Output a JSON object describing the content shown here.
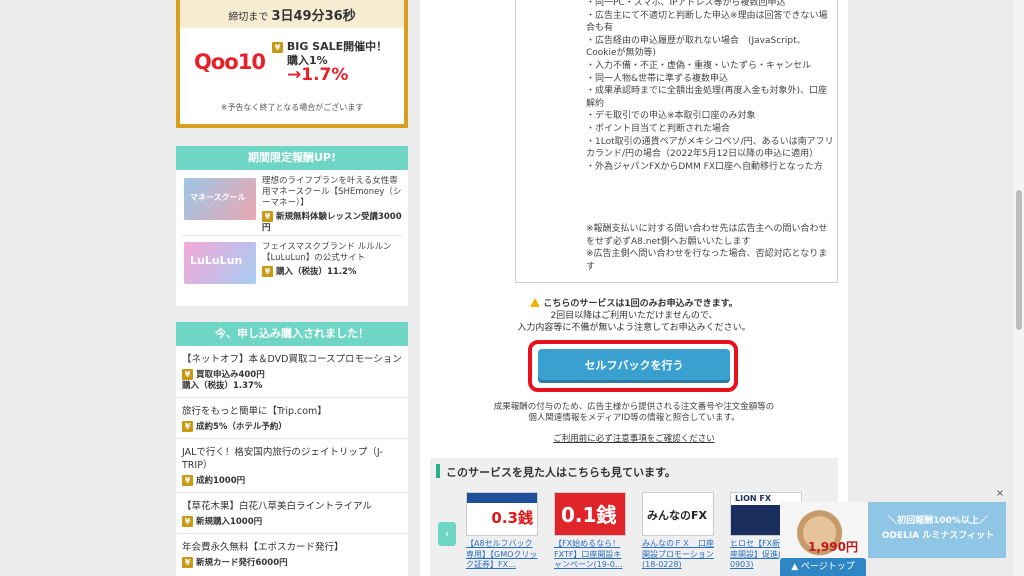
{
  "timer": {
    "label": "締切まで",
    "countdown": "3日49分36秒",
    "brand": "Qoo10",
    "sale": "BIG SALE開催中！",
    "reward_label": "購入1%",
    "rate": "→1.7%",
    "note": "※予告なく終了となる場合がございます"
  },
  "limited": {
    "heading": "期間限定報酬UP!",
    "items": [
      {
        "thumb_text": "マネースクール",
        "title": "理想のライフプランを叶える女性専用マネースクール【SHEmoney（シーマネー）】",
        "reward": "新規無料体験レッスン受講3000円"
      },
      {
        "thumb_text": "LuLuLun",
        "title": "フェイスマスクブランド ルルルン【LuLuLun】の公式サイト",
        "reward": "購入（税抜）11.2%"
      }
    ]
  },
  "recent": {
    "heading": "今、申し込み購入されました！",
    "items": [
      {
        "title": "【ネットオフ】本＆DVD買取コースプロモーション",
        "reward": "買取申込み400円\n購入（税抜）1.37%"
      },
      {
        "title": "旅行をもっと簡単に【Trip.com】",
        "reward": "成約5%（ホテル予約）"
      },
      {
        "title": "JALで行く！格安国内旅行のジェイトリップ（J-TRIP）",
        "reward": "成約1000円"
      },
      {
        "title": "【草花木果】白花八草美白ライントライアル",
        "reward": "新規購入1000円"
      },
      {
        "title": "年会費永久無料【エポスカード発行】",
        "reward": "新規カード発行6000円"
      }
    ]
  },
  "terms": {
    "lines": "・同一PC・スマホ、IPアドレス等から複数回申込\n・広告主にて不適切と判断した申込※理由は回答できない場合も有\n・広告経由の申込履歴が取れない場合　(JavaScript、Cookieが無効等)\n・入力不備・不正・虚偽・重複・いたずら・キャンセル\n・同一人物&世帯に準ずる複数申込\n・成果承認時までに全額出金処理(再度入金も対象外)、口座解約\n・デモ取引での申込※本取引口座のみ対象\n・ポイント目当てと判断された場合\n・1Lot取引の通貨ペアがメキシコペソ/円、あるいは南アフリカランド/円の場合（2022年5月12日以降の申込に適用）\n・外為ジャパンFXからDMM FX口座へ自動移行となった方",
    "notes": "※報酬支払いに対する問い合わせ先は広告主への問い合わせをせず必ずA8.net側へお願いいたします\n※広告主側へ問い合わせを行なった場合、否認対応となります"
  },
  "once": {
    "title": "こちらのサービスは1回のみお申込みできます。",
    "line1": "2回目以降はご利用いただけませんので、",
    "line2": "入力内容等に不備が無いよう注意してお申込みください。"
  },
  "selfback_button": "セルフバックを行う",
  "after_note": {
    "line1": "成果報酬の付与のため、広告主様から提供される注文番号や注文金額等の",
    "line2": "個人関連情報をメディアID等の情報と照合しています。"
  },
  "notice_link": "ご利用前に必ず注意事項をご確認ください",
  "recommend": {
    "heading": "このサービスを見た人はこちらも見ています。",
    "items": [
      {
        "thumb": "0.3銭",
        "caption": "【A8セルフバック専用】【GMOクリック証券】FX..."
      },
      {
        "thumb": "0.1銭",
        "caption": "【FX始めるなら！FXTF】口座開設キャンペーン(19-0..."
      },
      {
        "thumb": "みんなのFX",
        "caption": "みんなのＦＸ　口座開設プロモーション(18-0228)"
      },
      {
        "thumb": "LION FX",
        "caption": "ヒロセ【FX新規口座開設】促進(07-0903)"
      }
    ]
  },
  "ad": {
    "price": "1,990円",
    "line1": "＼初回報酬100%以上／",
    "line2": "ODELIA ルミナスフィット",
    "close": "×"
  },
  "page_top": "▲ ページトップ",
  "colors": {
    "accent": "#3aa0d0",
    "highlight": "#e8101c",
    "panel_head": "#6fd6c6",
    "gold": "#d8a020"
  }
}
